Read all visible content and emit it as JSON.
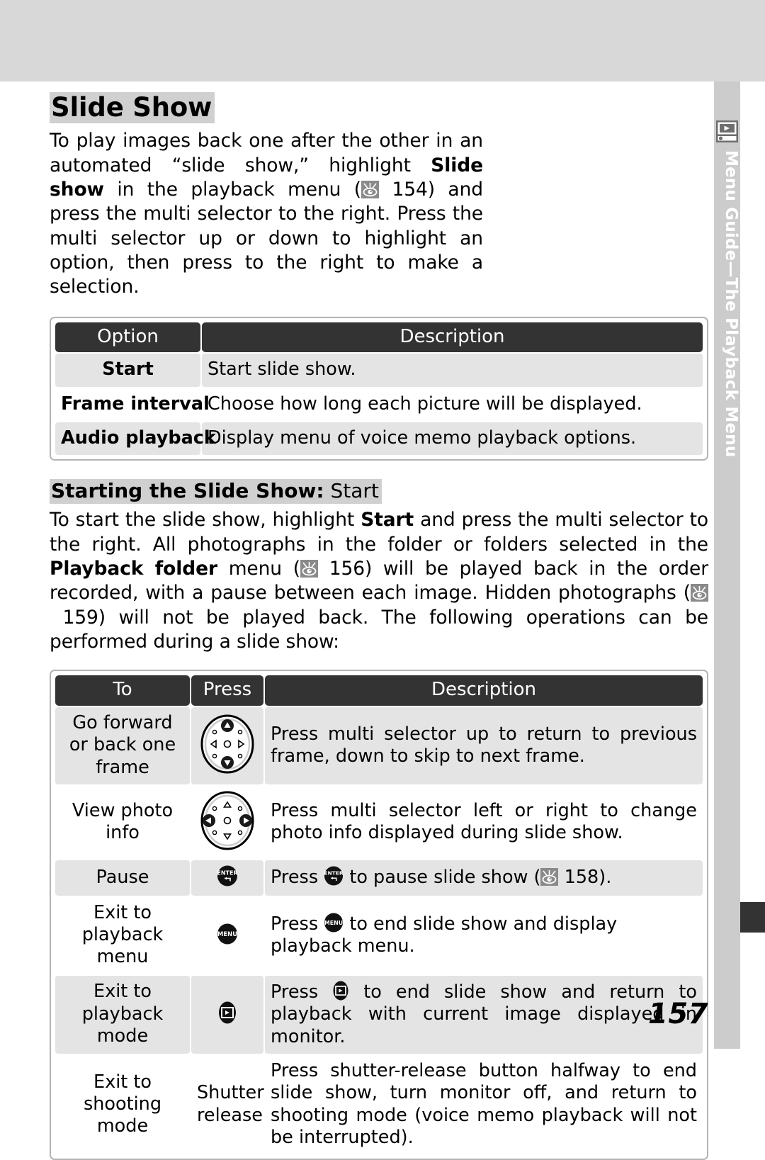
{
  "sidebar": {
    "icon": "playback-monitor-icon",
    "label": "Menu Guide—The Playback Menu"
  },
  "page_number": "157",
  "section": {
    "title": "Slide Show",
    "intro_parts": [
      "To play images back one after the other in an automated “slide show,” highlight ",
      "Slide show",
      " in the playback menu (",
      "154",
      ") and press the multi selector to the right.  Press the multi selector up or down to highlight an option, then press to the right to make a selection."
    ]
  },
  "option_table": {
    "headers": [
      "Option",
      "Description"
    ],
    "rows": [
      {
        "option": "Start",
        "description": "Start slide show."
      },
      {
        "option": "Frame interval",
        "description": "Choose how long each picture will be displayed."
      },
      {
        "option": "Audio playback",
        "description": "Display menu of voice memo playback options."
      }
    ]
  },
  "subsection": {
    "title_bold": "Starting the Slide Show:",
    "title_light": " Start",
    "body_parts": [
      "To start the slide show, highlight ",
      "Start",
      " and press the multi selector to the right.  All photographs in the folder or folders selected in the ",
      "Playback folder",
      " menu (",
      "156",
      ") will be played back in the order recorded, with a pause between each image.  Hidden photographs (",
      "159",
      ") will not be played back.  The following operations can be performed during a slide show:"
    ]
  },
  "operations_table": {
    "headers": [
      "To",
      "Press",
      "Description"
    ],
    "rows": [
      {
        "to": "Go forward or back one frame",
        "press_icon": "multi-selector-updown-icon",
        "press_text": "",
        "description": "Press multi selector up to return to previous frame, down to skip to next frame."
      },
      {
        "to": "View photo info",
        "press_icon": "multi-selector-leftright-icon",
        "press_text": "",
        "description_parts": [
          "Press multi selector left or right to change photo info displayed during slide show."
        ]
      },
      {
        "to": "Pause",
        "press_icon": "enter-button-icon",
        "press_text": "",
        "description_parts": [
          "Press ",
          " to pause slide show (",
          "158",
          ")."
        ]
      },
      {
        "to": "Exit to playback menu",
        "press_icon": "menu-button-icon",
        "press_text": "",
        "description_parts": [
          "Press ",
          " to end slide show and display playback menu."
        ]
      },
      {
        "to": "Exit to playback mode",
        "press_icon": "playback-button-icon",
        "press_text": "",
        "description_parts": [
          "Press ",
          " to end slide show and return to playback with current image displayed in monitor."
        ]
      },
      {
        "to": "Exit to shooting mode",
        "press_icon": "",
        "press_text": "Shutter release",
        "description_parts": [
          "Press shutter-release button halfway to end slide show, turn monitor off, and return to shooting mode (voice memo playback will not be interrupted)."
        ]
      }
    ]
  },
  "colors": {
    "band": "#d8d8d8",
    "tab": "#cccccc",
    "header_row": "#333333",
    "shade_row": "#e4e4e4",
    "highlight": "#d0d0d0"
  }
}
